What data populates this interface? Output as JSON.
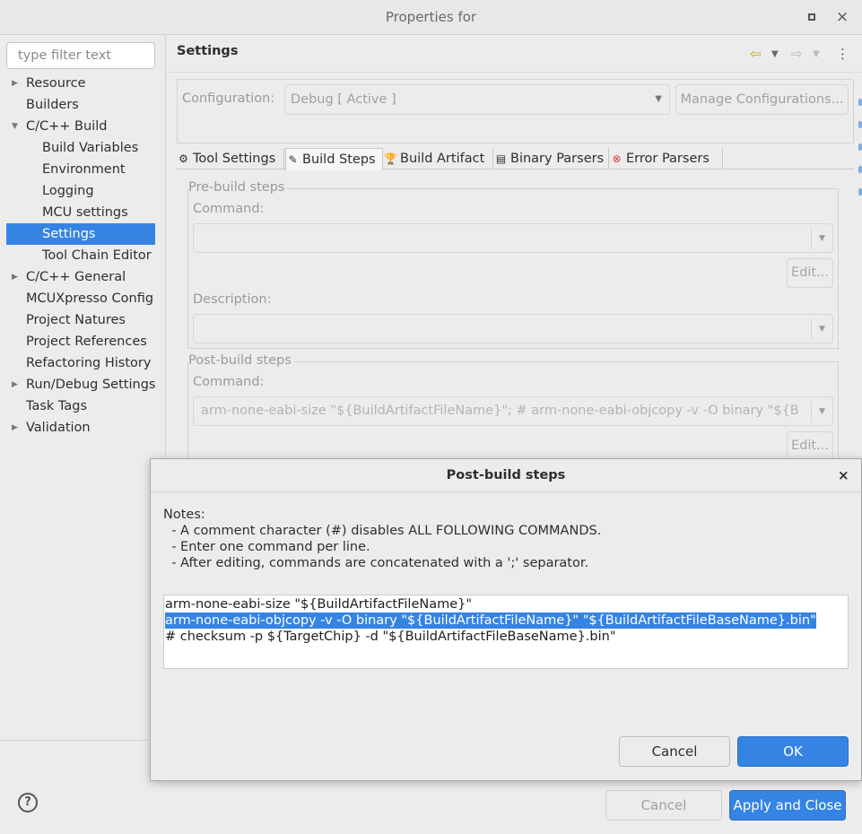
{
  "window": {
    "title": "Properties for"
  },
  "filter": {
    "placeholder": "type filter text"
  },
  "tree": [
    {
      "label": "Resource",
      "arrow": "▶",
      "child": false,
      "selected": false
    },
    {
      "label": "Builders",
      "arrow": "",
      "child": false,
      "selected": false
    },
    {
      "label": "C/C++ Build",
      "arrow": "▼",
      "child": false,
      "selected": false
    },
    {
      "label": "Build Variables",
      "arrow": "",
      "child": true,
      "selected": false
    },
    {
      "label": "Environment",
      "arrow": "",
      "child": true,
      "selected": false
    },
    {
      "label": "Logging",
      "arrow": "",
      "child": true,
      "selected": false
    },
    {
      "label": "MCU settings",
      "arrow": "",
      "child": true,
      "selected": false
    },
    {
      "label": "Settings",
      "arrow": "",
      "child": true,
      "selected": true
    },
    {
      "label": "Tool Chain Editor",
      "arrow": "",
      "child": true,
      "selected": false
    },
    {
      "label": "C/C++ General",
      "arrow": "▶",
      "child": false,
      "selected": false
    },
    {
      "label": "MCUXpresso Config",
      "arrow": "",
      "child": false,
      "selected": false
    },
    {
      "label": "Project Natures",
      "arrow": "",
      "child": false,
      "selected": false
    },
    {
      "label": "Project References",
      "arrow": "",
      "child": false,
      "selected": false
    },
    {
      "label": "Refactoring History",
      "arrow": "",
      "child": false,
      "selected": false
    },
    {
      "label": "Run/Debug Settings",
      "arrow": "▶",
      "child": false,
      "selected": false
    },
    {
      "label": "Task Tags",
      "arrow": "",
      "child": false,
      "selected": false
    },
    {
      "label": "Validation",
      "arrow": "▶",
      "child": false,
      "selected": false
    }
  ],
  "settings": {
    "title": "Settings",
    "configuration_label": "Configuration:",
    "configuration_value": "Debug  [ Active ]",
    "manage_button": "Manage Configurations...",
    "tabs": [
      {
        "label": "Tool Settings",
        "icon": "⚙",
        "icon_name": "tool-settings-icon"
      },
      {
        "label": "Build Steps",
        "icon": "✎",
        "icon_name": "build-steps-icon"
      },
      {
        "label": "Build Artifact",
        "icon": "🏆",
        "icon_name": "build-artifact-icon"
      },
      {
        "label": "Binary Parsers",
        "icon": "▤",
        "icon_name": "binary-parsers-icon"
      },
      {
        "label": "Error Parsers",
        "icon": "⊗",
        "icon_name": "error-parsers-icon"
      }
    ],
    "prebuild": {
      "title": "Pre-build steps",
      "command_label": "Command:",
      "command_value": "",
      "edit_button": "Edit...",
      "description_label": "Description:",
      "description_value": ""
    },
    "postbuild": {
      "title": "Post-build steps",
      "command_label": "Command:",
      "command_value": "arm-none-eabi-size \"${BuildArtifactFileName}\"; # arm-none-eabi-objcopy -v -O binary \"${B",
      "edit_button": "Edit..."
    }
  },
  "footer": {
    "help": "?",
    "cancel": "Cancel",
    "apply": "Apply and Close"
  },
  "dialog": {
    "title": "Post-build steps",
    "close": "×",
    "notes": [
      "Notes:",
      "  - A comment character (#) disables ALL FOLLOWING COMMANDS.",
      "  - Enter one command per line.",
      "  - After editing, commands are concatenated with a ';' separator."
    ],
    "lines": [
      "arm-none-eabi-size \"${BuildArtifactFileName}\"",
      "arm-none-eabi-objcopy -v -O binary \"${BuildArtifactFileName}\" \"${BuildArtifactFileBaseName}.bin\"",
      "# checksum -p ${TargetChip} -d \"${BuildArtifactFileBaseName}.bin\""
    ],
    "selected_line": 1,
    "cancel": "Cancel",
    "ok": "OK"
  },
  "colors": {
    "accent": "#3584e4",
    "back_arrow": "#c9a21b"
  }
}
